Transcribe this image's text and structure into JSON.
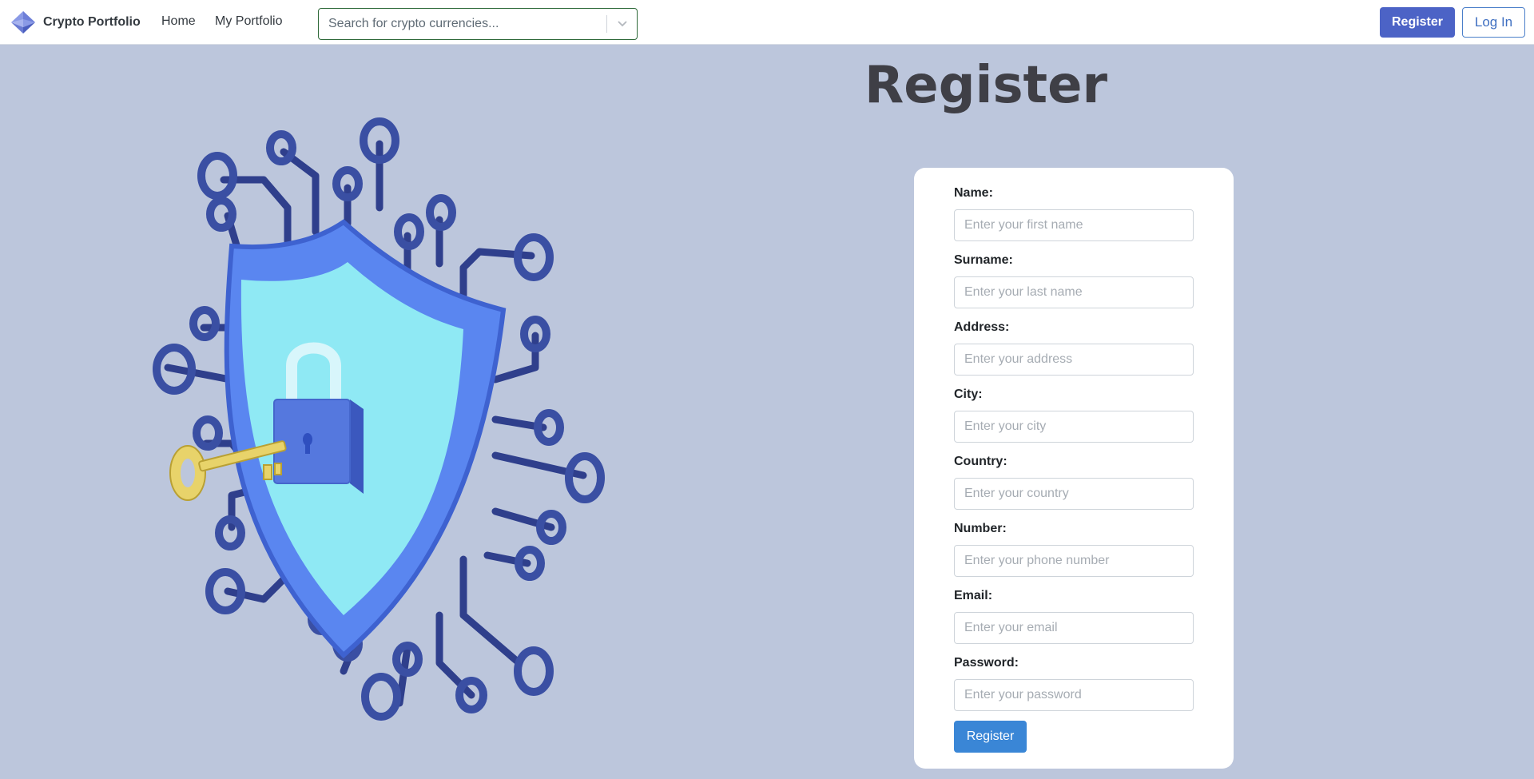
{
  "navbar": {
    "brand": "Crypto Portfolio",
    "brand_icon": "ethereum-diamond-icon",
    "links": [
      "Home",
      "My Portfolio"
    ],
    "search_placeholder": "Search for crypto currencies...",
    "register_label": "Register",
    "login_label": "Log In"
  },
  "page": {
    "title": "Register",
    "illustration": "security-shield-with-padlock-and-key"
  },
  "form": {
    "fields": [
      {
        "label": "Name:",
        "placeholder": "Enter your first name",
        "value": ""
      },
      {
        "label": "Surname:",
        "placeholder": "Enter your last name",
        "value": ""
      },
      {
        "label": "Address:",
        "placeholder": "Enter your address",
        "value": ""
      },
      {
        "label": "City:",
        "placeholder": "Enter your city",
        "value": ""
      },
      {
        "label": "Country:",
        "placeholder": "Enter your country",
        "value": ""
      },
      {
        "label": "Number:",
        "placeholder": "Enter your phone number",
        "value": ""
      },
      {
        "label": "Email:",
        "placeholder": "Enter your email",
        "value": ""
      },
      {
        "label": "Password:",
        "placeholder": "Enter your password",
        "value": ""
      }
    ],
    "submit_label": "Register"
  },
  "colors": {
    "background": "#bcc6dc",
    "primary": "#4c63c6",
    "submit": "#3a86d6",
    "shield": "#5a86f0",
    "shield_inner": "#8fe9f4",
    "circuit": "#3a4fa3",
    "key": "#e8d36a"
  }
}
